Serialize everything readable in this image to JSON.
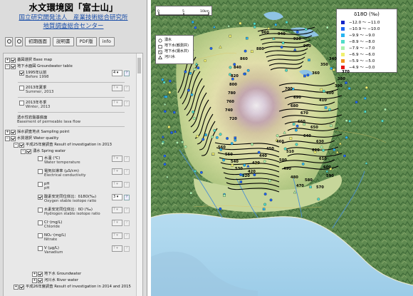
{
  "panel": {
    "title": "水文環境図「富士山」",
    "org_line1": "国立研究開発法人　産業技術総合研究所",
    "org_line2": "地質調査総合センター",
    "toolbar": [
      "初期画面",
      "説明書",
      "PDF版",
      "info"
    ],
    "tree": [
      {
        "label": "基図選択 Base map"
      },
      {
        "label": "地下水面図 Groundwater table"
      },
      {
        "label": "1995年以前",
        "sub": "Before 1998",
        "select": "4"
      },
      {
        "label": "2013年夏季",
        "sub": "Summer, 2013",
        "select": "?"
      },
      {
        "label": "2013年冬季",
        "sub": "Winter, 2013",
        "select": "?"
      },
      {
        "label": "透水性岩盤基底面",
        "sub": "Basement of permeable lava flow"
      },
      {
        "label": "採水調査地点 Sampling point"
      },
      {
        "label": "水質選択 Water quality"
      },
      {
        "label": "平成25年度調査 Result of investigation in 2013"
      },
      {
        "label": "湧水 Spring water"
      },
      {
        "label": "水温 (℃)",
        "sub": "Water temperature",
        "select": "?"
      },
      {
        "label": "電気伝導率 (μS/cm)",
        "sub": "Electrical conductivity",
        "select": "?"
      },
      {
        "label": "pH",
        "sub": "pH",
        "select": "?"
      },
      {
        "label": "酸素安定同位体比：δ18O(‰)",
        "sub": "Oxygen stable isotope ratio",
        "select": "3"
      },
      {
        "label": "水素安定同位体比：δD (‰)",
        "sub": "Hydrogen stable isotope ratio",
        "select": "?"
      },
      {
        "label": "Cl⁻(mg/L)",
        "sub": "Chloride",
        "select": "?"
      },
      {
        "label": "NO₃⁻(mg/L)",
        "sub": "Nitrate",
        "select": "?"
      },
      {
        "label": "V (μg/L)",
        "sub": "Vanadium",
        "select": "?"
      },
      {
        "label": "地下水 Groundwater"
      },
      {
        "label": "河川水 River water"
      },
      {
        "label": "平成26年度調査 Result of investigation in 2014 and 2015"
      }
    ]
  },
  "map": {
    "scale_labels": [
      "0",
      "5",
      "10km"
    ],
    "legend_left": [
      "湧水",
      "地下水(観測井)",
      "地下水(揚水井)",
      "河川水"
    ],
    "legend_right": {
      "title": "δ18O (‰)",
      "items": [
        {
          "label": "−12.0 〜 −11.0",
          "color": "#1424c8"
        },
        {
          "label": "−10.9 〜 −10.0",
          "color": "#1e64f0"
        },
        {
          "label": "−9.9 〜 −9.0",
          "color": "#28b4f0"
        },
        {
          "label": "−8.9 〜 −8.0",
          "color": "#50dcc8"
        },
        {
          "label": "−7.9 〜 −7.0",
          "color": "#aaf0aa"
        },
        {
          "label": "−6.9 〜 −6.0",
          "color": "#f0f06e"
        },
        {
          "label": "−5.9 〜 −5.0",
          "color": "#f0961e"
        },
        {
          "label": "−4.9 〜 −0.0",
          "color": "#e61414"
        }
      ]
    },
    "contour_labels": [
      "960",
      "940",
      "920",
      "900",
      "880",
      "860",
      "840",
      "820",
      "800",
      "780",
      "760",
      "740",
      "720",
      "700",
      "690",
      "680",
      "670",
      "660",
      "650",
      "640",
      "630",
      "620",
      "610",
      "600",
      "590",
      "580",
      "570",
      "560",
      "550",
      "540",
      "530",
      "520",
      "510",
      "500",
      "490",
      "480",
      "470",
      "460",
      "450",
      "440",
      "430",
      "420",
      "410",
      "400",
      "390",
      "380",
      "370",
      "360",
      "350",
      "340",
      "330",
      "320",
      "310",
      "300",
      "290",
      "280",
      "270",
      "260",
      "250",
      "240",
      "230",
      "220",
      "210",
      "200",
      "190",
      "180",
      "170",
      "160",
      "150",
      "140",
      "130",
      "120",
      "110",
      "100"
    ]
  }
}
